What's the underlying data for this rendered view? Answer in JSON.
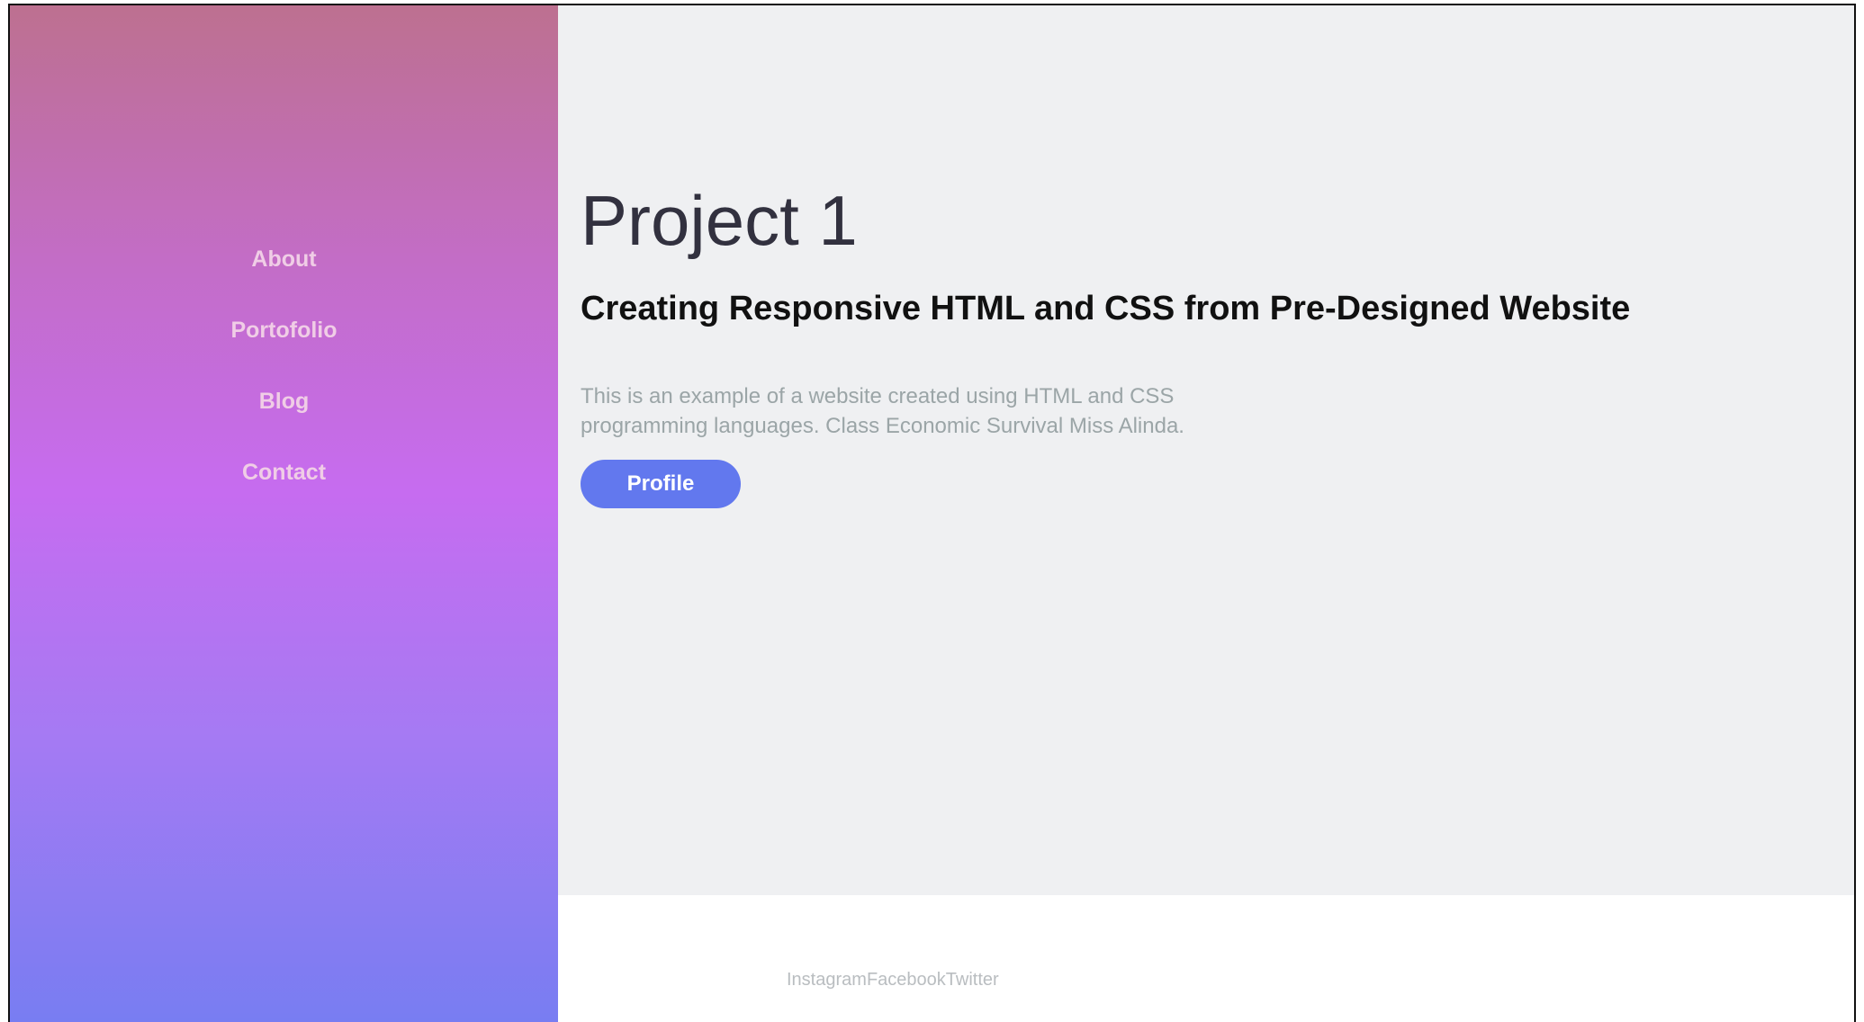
{
  "nav": {
    "items": [
      {
        "label": "About"
      },
      {
        "label": "Portofolio"
      },
      {
        "label": "Blog"
      },
      {
        "label": "Contact"
      }
    ]
  },
  "main": {
    "title": "Project 1",
    "subtitle": "Creating Responsive HTML and CSS from Pre-Designed Website",
    "description": "This is an example of a website created using HTML and CSS programming languages. Class Economic Survival Miss Alinda.",
    "button_label": "Profile"
  },
  "footer": {
    "social": [
      {
        "label": "Instagram"
      },
      {
        "label": "Facebook"
      },
      {
        "label": "Twitter"
      }
    ]
  },
  "colors": {
    "sidebar_gradient_top": "#bd7090",
    "sidebar_gradient_mid": "#c66cf0",
    "sidebar_gradient_bottom": "#787df2",
    "main_background": "#eff0f2",
    "button_background": "#6278ee",
    "title_text": "#32313f",
    "nav_text": "#f0cde6"
  }
}
